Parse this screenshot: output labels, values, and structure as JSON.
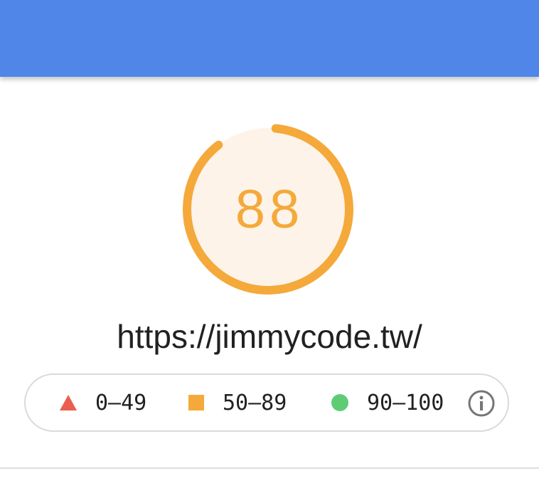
{
  "header": {
    "background": "#4f86e8"
  },
  "gauge": {
    "score": "88",
    "score_fraction": 0.88,
    "color": "#f4a93a",
    "fill_color": "#fdf3e9"
  },
  "report": {
    "url": "https://jimmycode.tw/"
  },
  "legend": {
    "items": [
      {
        "label": "0–49",
        "shape": "triangle",
        "color": "#eb5e4f"
      },
      {
        "label": "50–89",
        "shape": "square",
        "color": "#f4a93a"
      },
      {
        "label": "90–100",
        "shape": "circle",
        "color": "#5fcc75"
      }
    ],
    "info_icon": "info-icon"
  }
}
